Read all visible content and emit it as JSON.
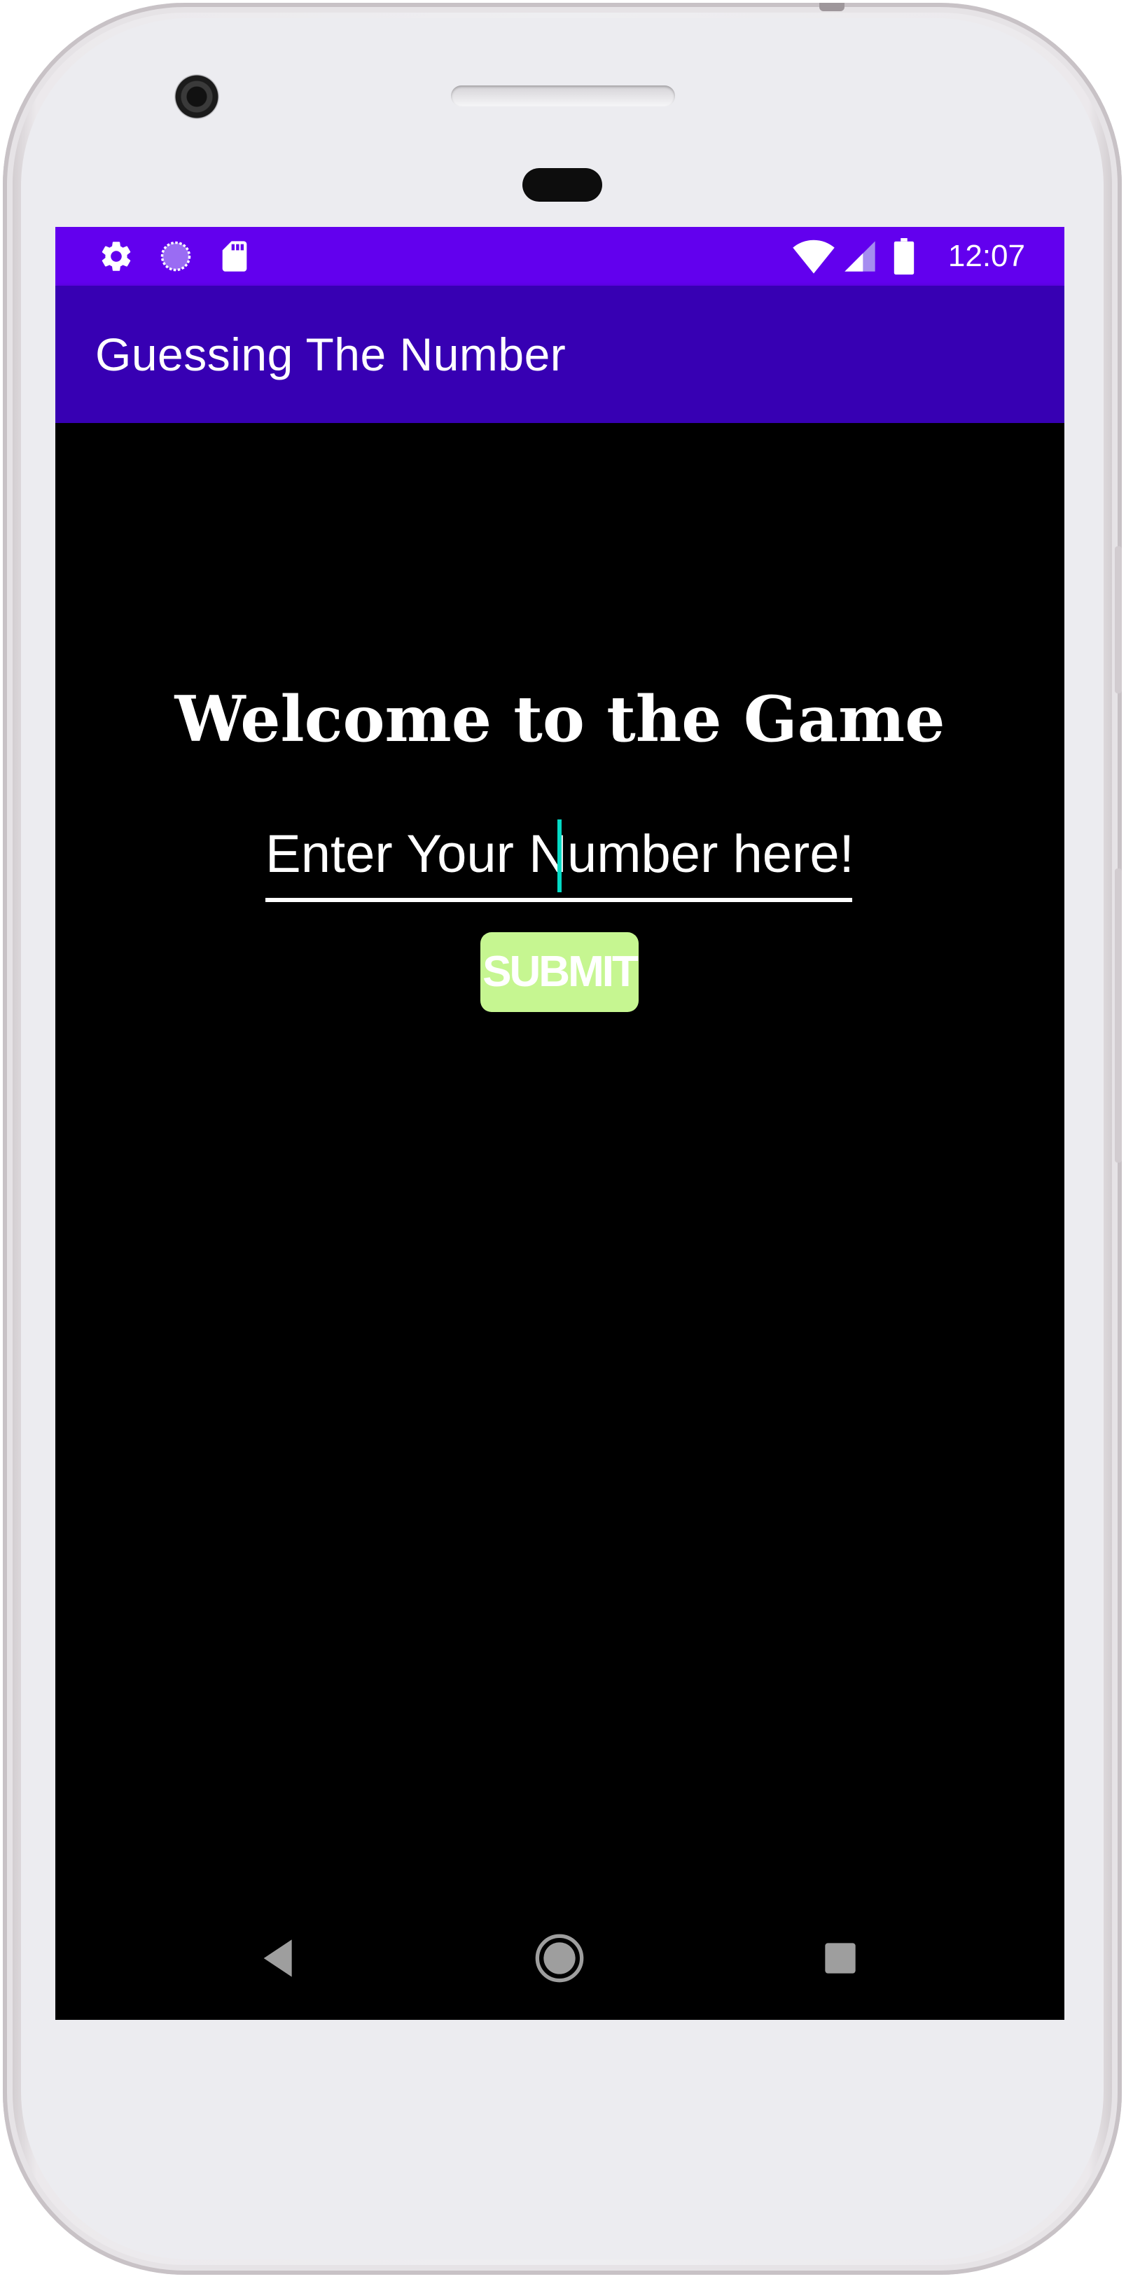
{
  "device": {
    "frame_color": "#eeeef1",
    "screen_color": "#000000"
  },
  "status_bar": {
    "background": "#6200ee",
    "left_icons": [
      "settings-gear-icon",
      "sync-spinner-icon",
      "sd-card-icon"
    ],
    "right_icons": [
      "wifi-icon",
      "cellular-signal-icon",
      "battery-icon"
    ],
    "time": "12:07"
  },
  "app_bar": {
    "background": "#3700b3",
    "title": "Guessing The Number"
  },
  "main": {
    "welcome_text": "Welcome to the Game",
    "number_input": {
      "placeholder": "Enter Your Number here!",
      "value": "",
      "cursor_color": "#03dac5"
    },
    "submit_button": {
      "label": "SUBMIT",
      "background": "#c6f691"
    }
  },
  "nav_bar": {
    "buttons": [
      "back-icon",
      "home-icon",
      "recents-icon"
    ]
  }
}
